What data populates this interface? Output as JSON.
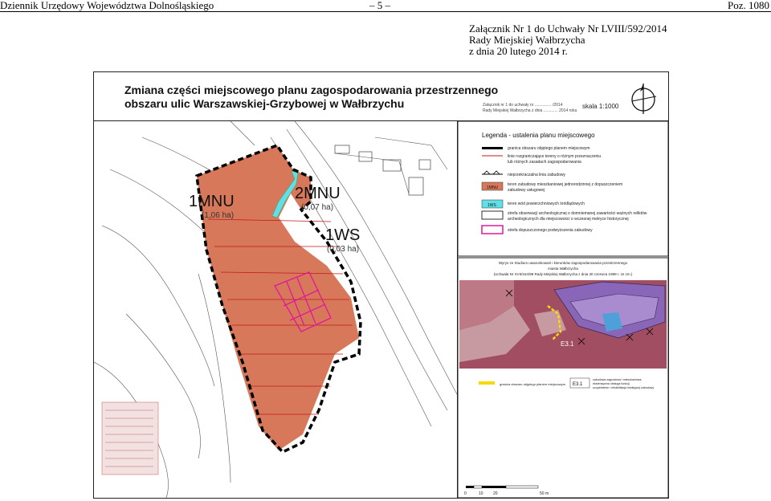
{
  "header": {
    "left": "Dziennik Urzędowy Województwa Dolnośląskiego",
    "center": "– 5 –",
    "right": "Poz. 1080"
  },
  "attachment": {
    "line1": "Załącznik Nr 1 do Uchwały Nr LVIII/592/2014",
    "line2": "Rady Miejskiej Wałbrzycha",
    "line3": "z dnia 20 lutego 2014 r."
  },
  "map": {
    "title_line1": "Zmiana części miejscowego planu zagospodarowania przestrzennego",
    "title_line2": "obszaru ulic Warszawskiej-Grzybowej w Wałbrzychu",
    "stamp_line1": "Załącznik nr 1 do uchwały nr ............... /2014",
    "stamp_line2": "Rady Miejskiej Wałbrzycha z dnia ............. 2014 roku",
    "scale": "skala 1:1000",
    "zones": [
      {
        "code": "1MNU",
        "area": "(1,06 ha)"
      },
      {
        "code": "2MNU",
        "area": "(0,07 ha)"
      },
      {
        "code": "1WS",
        "area": "(0,03 ha)"
      }
    ],
    "scale_bar": [
      "0",
      "10",
      "20",
      "50 m"
    ]
  },
  "legend": {
    "title": "Legenda - ustalenia planu miejscowego",
    "items": [
      {
        "label": "granica obszaru objętego planem miejscowym",
        "code": ""
      },
      {
        "label": "linie rozgraniczające tereny o różnym przeznaczeniu",
        "code": ""
      },
      {
        "label": "lub różnych zasadach zagospodarowania",
        "code": ""
      },
      {
        "label": "nieprzekraczalna linia zabudowy",
        "code": ""
      },
      {
        "label": "teren zabudowy mieszkaniowej jednorodzinnej z dopuszczeniem",
        "code": "1MNU"
      },
      {
        "label": "zabudowy usługowej",
        "code": ""
      },
      {
        "label": "teren wód powierzchniowych śródlądowych",
        "code": "1WS"
      },
      {
        "label": "strefa obserwacji archeologicznej o domniemanej zawartości ważnych reliktów",
        "code": ""
      },
      {
        "label": "archeologicznych dla miejscowości o wczesnej metryce historycznej",
        "code": ""
      },
      {
        "label": "strefa dopuszczonego podwyższenia zabudowy",
        "code": ""
      }
    ]
  },
  "study": {
    "title1": "Wyrys ze Studium uwarunkowań i kierunków zagospodarowania przestrzennego",
    "title2": "miasta Wałbrzycha",
    "title3": "(Uchwała Nr XVII/164/99 Rady Miejskiej Wałbrzycha z dnia 30 czerwca 1999 r. ze zm.)",
    "label": "E3.1",
    "legend_boundary": "granica obszaru objętego planem miejscowym",
    "legend_code": "E3.1",
    "legend_desc1": "zabudowa zagrodowa i mieszkaniowa,",
    "legend_desc2": "ekstensywna obsługa funkcji,",
    "legend_desc3": "uzupełnienie i rehabilitacja istniejącej zabudowy"
  },
  "colors": {
    "zone_fill": "#d7785a",
    "water": "#5fe0e6",
    "raise_zone": "#e0189a",
    "study_bg": "#a24e62",
    "study_purple": "#8a66b8",
    "study_blue": "#4da0d8",
    "boundary_yellow": "#f5d90a"
  }
}
